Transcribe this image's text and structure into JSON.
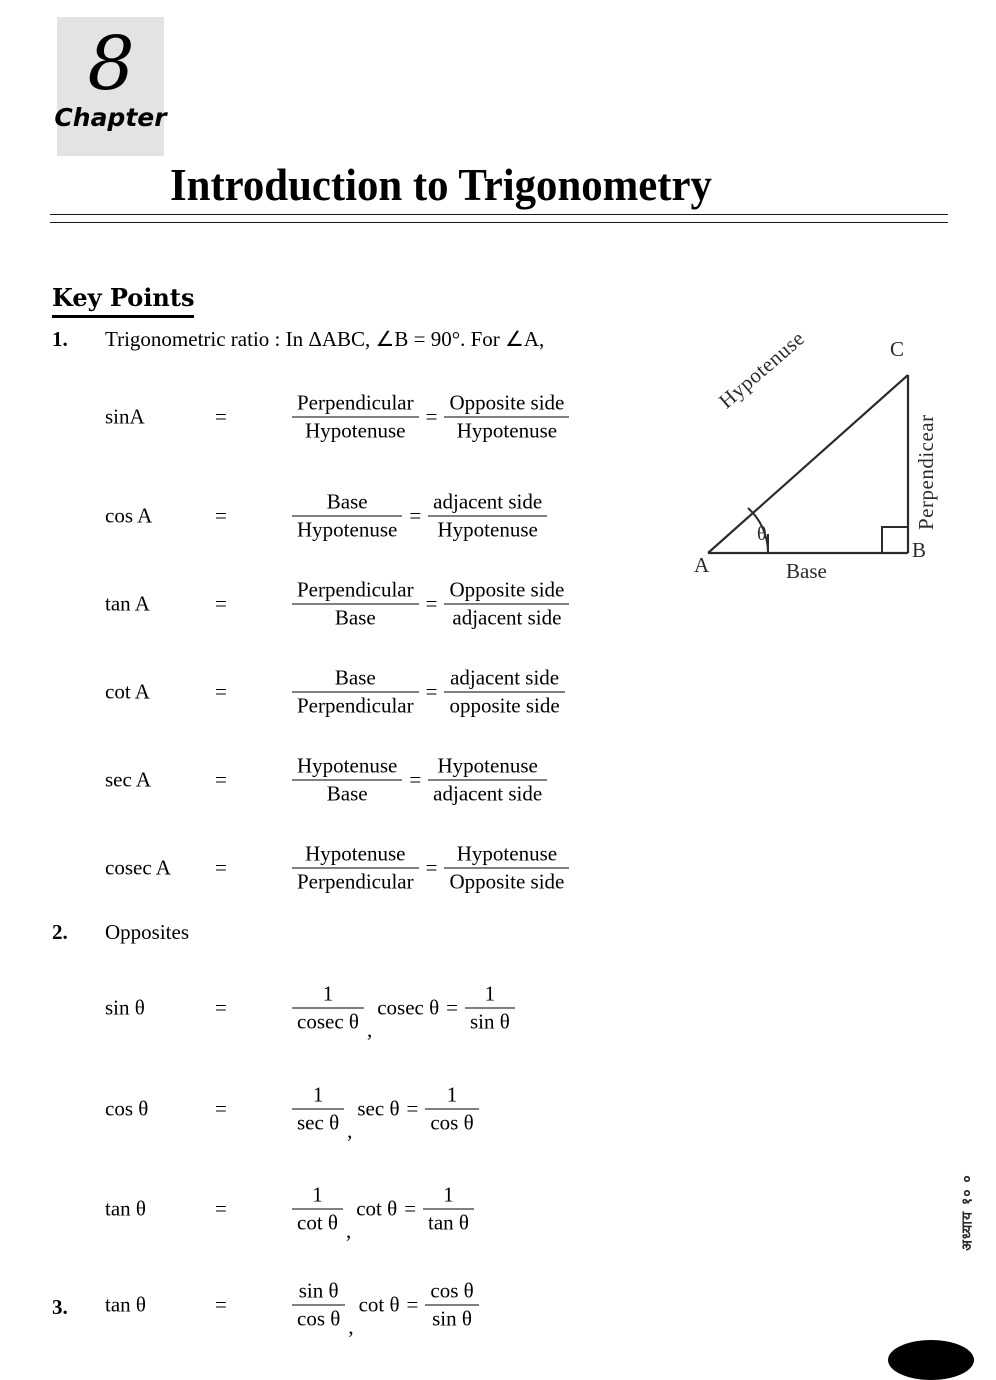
{
  "chapter": {
    "number": "8",
    "word": "Chapter"
  },
  "title": "Introduction to Trigonometry",
  "keypoints_heading": "Key Points",
  "items": [
    {
      "num": "1.",
      "text": "Trigonometric ratio : In ΔABC, ∠B = 90°. For ∠A,"
    },
    {
      "num": "2.",
      "text": "Opposites"
    },
    {
      "num": "3.",
      "text": ""
    }
  ],
  "ratios": [
    {
      "name": "sinA",
      "eq": "=",
      "n1": "Perpendicular",
      "d1": "Hypotenuse",
      "mid": "=",
      "n2": "Opposite side",
      "d2": "Hypotenuse"
    },
    {
      "name": "cos A",
      "eq": "=",
      "n1": "Base",
      "d1": "Hypotenuse",
      "mid": "=",
      "n2": "adjacent side",
      "d2": "Hypotenuse"
    },
    {
      "name": "tan  A",
      "eq": "=",
      "n1": "Perpendicular",
      "d1": "Base",
      "mid": "=",
      "n2": "Opposite side",
      "d2": "adjacent side"
    },
    {
      "name": "cot A",
      "eq": "=",
      "n1": "Base",
      "d1": "Perpendicular",
      "mid": "=",
      "n2": "adjacent side",
      "d2": "opposite side"
    },
    {
      "name": "sec A",
      "eq": "=",
      "n1": "Hypotenuse",
      "d1": "Base",
      "mid": "=",
      "n2": "Hypotenuse",
      "d2": "adjacent side"
    },
    {
      "name": "cosec A",
      "eq": "=",
      "n1": "Hypotenuse",
      "d1": "Perpendicular",
      "mid": "=",
      "n2": "Hypotenuse",
      "d2": "Opposite side"
    }
  ],
  "reciprocals": [
    {
      "name": "sin θ",
      "eq": "=",
      "n1": "1",
      "d1": "cosec θ",
      "comma": ",",
      "lhs2": "cosec θ",
      "mid": "=",
      "n2": "1",
      "d2": "sin θ"
    },
    {
      "name": "cos θ",
      "eq": "=",
      "n1": "1",
      "d1": "sec θ",
      "comma": ",",
      "lhs2": "sec θ",
      "mid": "=",
      "n2": "1",
      "d2": "cos θ"
    },
    {
      "name": "tan θ",
      "eq": "=",
      "n1": "1",
      "d1": "cot θ",
      "comma": ",",
      "lhs2": "cot θ",
      "mid": "=",
      "n2": "1",
      "d2": "tan θ"
    }
  ],
  "quotient": {
    "name": "tan θ",
    "eq": "=",
    "n1": "sin θ",
    "d1": "cos θ",
    "comma": ",",
    "lhs2": "cot θ",
    "mid": "=",
    "n2": "cos θ",
    "d2": "sin θ"
  },
  "triangle": {
    "vertex_a": "A",
    "vertex_b": "B",
    "vertex_c": "C",
    "hypotenuse": "Hypotenuse",
    "perpendicular": "Perpendicear",
    "base": "Base",
    "angle": "θ"
  },
  "watermark": "अध्याय  १०  ०",
  "colors": {
    "badge_background": "#e3e3e3",
    "figure_stroke": "#2b2b2b",
    "text": "#000000"
  }
}
